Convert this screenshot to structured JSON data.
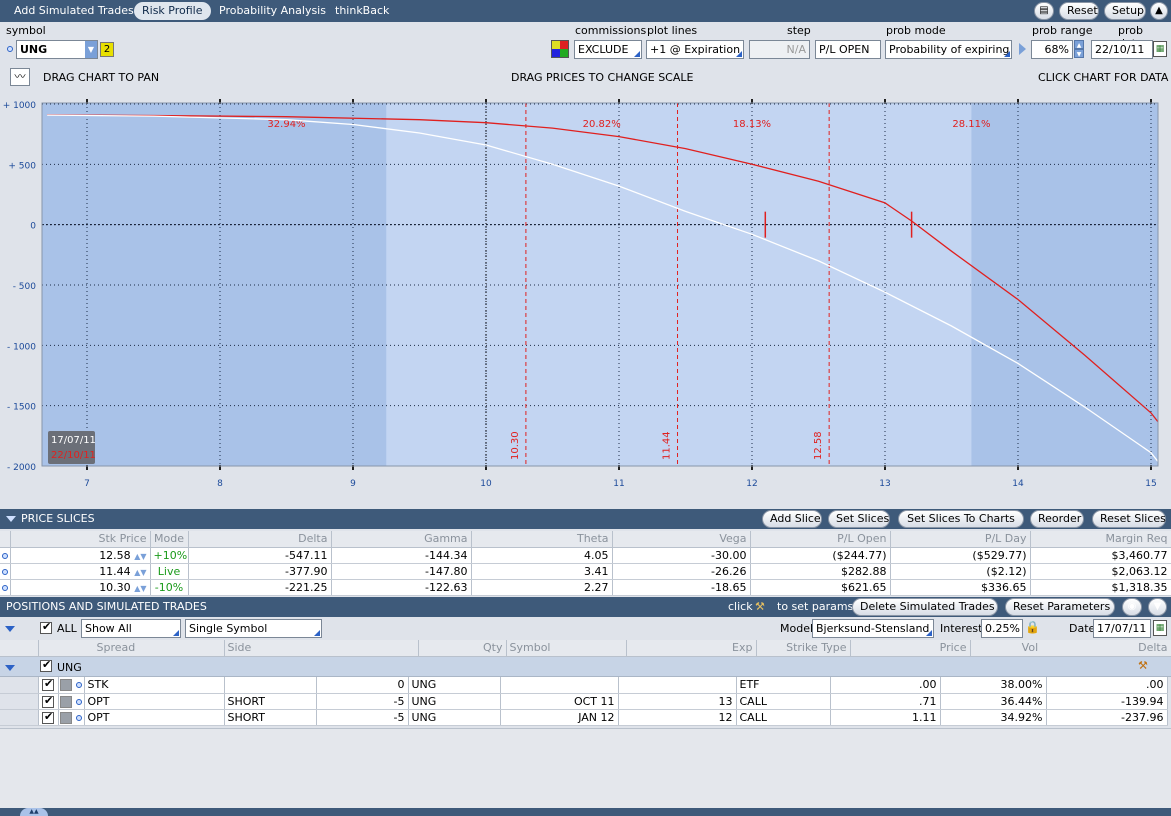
{
  "tabs": [
    {
      "label": "Add Simulated Trades",
      "active": false
    },
    {
      "label": "Risk Profile",
      "active": true
    },
    {
      "label": "Probability Analysis",
      "active": false
    },
    {
      "label": "thinkBack",
      "active": false
    }
  ],
  "top_buttons": {
    "reset": "Reset",
    "setup": "Setup"
  },
  "controls": {
    "symbol_label": "symbol",
    "symbol_value": "UNG",
    "symbol_badge": "2",
    "commissions_label": "commissions",
    "commissions_value": "EXCLUDE",
    "plot_lines_label": "plot lines",
    "plot_lines_value": "+1 @ Expiration",
    "step_label": "step",
    "step_value": "N/A",
    "pl_value": "P/L OPEN",
    "prob_mode_label": "prob mode",
    "prob_mode_value": "Probability of expiring",
    "prob_range_label": "prob range",
    "prob_range_value": "68%",
    "prob_date_label": "prob date",
    "prob_date_value": "22/10/11"
  },
  "chart_header": {
    "left": "DRAG CHART TO PAN",
    "center": "DRAG PRICES TO CHANGE SCALE",
    "right": "CLICK CHART FOR DATA"
  },
  "chart_data": {
    "type": "line",
    "x_ticks": [
      7,
      8,
      9,
      10,
      11,
      12,
      13,
      14,
      15
    ],
    "y_ticks": [
      1000,
      500,
      0,
      -500,
      -1000,
      -1500,
      -2000
    ],
    "y_tick_labels": [
      "+ 1000",
      "+ 500",
      "0",
      "- 500",
      "- 1000",
      "- 1500",
      "- 2000"
    ],
    "xlim": [
      7,
      15
    ],
    "ylim": [
      -2000,
      1000
    ],
    "series": [
      {
        "color": "#e0201f",
        "x": [
          6.7,
          7.5,
          8.5,
          9.5,
          10.0,
          10.5,
          11.0,
          11.5,
          12.0,
          12.5,
          13.0,
          13.2,
          13.5,
          14.0,
          14.5,
          15.0,
          15.1
        ],
        "y": [
          910,
          905,
          895,
          870,
          845,
          800,
          730,
          630,
          500,
          360,
          180,
          30,
          -220,
          -620,
          -1080,
          -1560,
          -1700
        ]
      },
      {
        "color": "#ffffff",
        "x": [
          6.7,
          7.5,
          8.5,
          9.0,
          9.5,
          10.0,
          10.5,
          11.0,
          11.5,
          12.0,
          12.5,
          13.0,
          13.5,
          14.0,
          14.5,
          15.0,
          15.05
        ],
        "y": [
          908,
          900,
          870,
          830,
          760,
          660,
          500,
          320,
          110,
          -80,
          -300,
          -560,
          -840,
          -1150,
          -1510,
          -1890,
          -1960
        ]
      }
    ],
    "price_lines": [
      {
        "x": 10.3,
        "label": "10.30"
      },
      {
        "x": 11.44,
        "label": "11.44"
      },
      {
        "x": 12.58,
        "label": "12.58"
      }
    ],
    "live_line_x": 10.0,
    "breakevens": [
      12.1,
      13.2
    ],
    "prob_band": [
      9.25,
      13.65
    ],
    "probabilities": [
      {
        "x": 8.5,
        "label": "32.94%"
      },
      {
        "x": 10.87,
        "label": "20.82%"
      },
      {
        "x": 12.0,
        "label": "18.13%"
      },
      {
        "x": 13.65,
        "label": "28.11%"
      }
    ],
    "date_legend": [
      {
        "label": "17/07/11",
        "color": "#ffffff"
      },
      {
        "label": "22/10/11",
        "color": "#e0201f"
      }
    ],
    "grid": true
  },
  "price_slices": {
    "title": "PRICE SLICES",
    "buttons": [
      "Add Slice",
      "Set Slices",
      "Set Slices To Charts",
      "Reorder",
      "Reset Slices"
    ],
    "columns": [
      "Stk Price",
      "Mode",
      "Delta",
      "Gamma",
      "Theta",
      "Vega",
      "P/L Open",
      "P/L Day",
      "Margin Req"
    ],
    "rows": [
      {
        "stk": "12.58",
        "mode": "+10%",
        "delta": "-547.11",
        "gamma": "-144.34",
        "theta": "4.05",
        "vega": "-30.00",
        "pl_open": "($244.77)",
        "pl_day": "($529.77)",
        "margin": "$3,460.77"
      },
      {
        "stk": "11.44",
        "mode": "Live",
        "delta": "-377.90",
        "gamma": "-147.80",
        "theta": "3.41",
        "vega": "-26.26",
        "pl_open": "$282.88",
        "pl_day": "($2.12)",
        "margin": "$2,063.12"
      },
      {
        "stk": "10.30",
        "mode": "-10%",
        "delta": "-221.25",
        "gamma": "-122.63",
        "theta": "2.27",
        "vega": "-18.65",
        "pl_open": "$621.65",
        "pl_day": "$336.65",
        "margin": "$1,318.35"
      }
    ]
  },
  "positions": {
    "title": "POSITIONS AND SIMULATED TRADES",
    "click_text": "click",
    "set_params_text": "to set params",
    "buttons": [
      "Delete Simulated Trades",
      "Reset Parameters"
    ],
    "all_label": "ALL",
    "show_value": "Show All",
    "symbol_mode": "Single Symbol",
    "model_label": "Model",
    "model_value": "Bjerksund-Stensland",
    "interest_label": "Interest",
    "interest_value": "0.25%",
    "date_label": "Date",
    "date_value": "17/07/11",
    "columns": [
      "Spread",
      "Side",
      "Qty",
      "Symbol",
      "Exp",
      "Strike",
      "Type",
      "Price",
      "Vol",
      "Delta"
    ],
    "group": "UNG",
    "rows": [
      {
        "spread": "STK",
        "side": "",
        "qty": "0",
        "symbol": "UNG",
        "exp": "",
        "strike": "",
        "type": "ETF",
        "price": ".00",
        "vol": "38.00%",
        "delta": ".00"
      },
      {
        "spread": "OPT",
        "side": "SHORT",
        "qty": "-5",
        "symbol": "UNG",
        "exp": "OCT 11",
        "strike": "13",
        "type": "CALL",
        "price": ".71",
        "vol": "36.44%",
        "delta": "-139.94"
      },
      {
        "spread": "OPT",
        "side": "SHORT",
        "qty": "-5",
        "symbol": "UNG",
        "exp": "JAN 12",
        "strike": "12",
        "type": "CALL",
        "price": "1.11",
        "vol": "34.92%",
        "delta": "-237.96"
      }
    ]
  }
}
